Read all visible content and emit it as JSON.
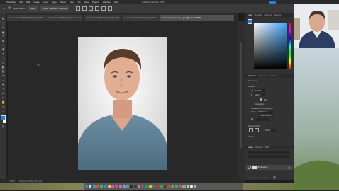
{
  "app": {
    "menus": [
      "Photoshop",
      "File",
      "Edit",
      "Image",
      "Layer",
      "Type",
      "Select",
      "Filter",
      "3D",
      "View",
      "Plugins",
      "Window",
      "Help"
    ],
    "window_title": "Adobe Photoshop 2024"
  },
  "options_bar": {
    "auto_select": "Auto-Select:",
    "layer_dropdown": "Layer",
    "show_transform": "Show Transform Controls"
  },
  "tabs": [
    {
      "label": "Adobe Stock 457698523.jpeg @ 16.7%"
    },
    {
      "label": "Adobe Stock 148765432.jpeg @ 16.7%"
    },
    {
      "label": "Adobe Stock 587542156.jpeg @ 16.7%"
    },
    {
      "label": "Adobe Stock 162458791.jpeg @ 16.7%"
    },
    {
      "label": "balloon_engagement_1.jpeg @ 17% (RGB/8)",
      "active": true
    }
  ],
  "status": {
    "zoom": "17.07%",
    "doc_info": "2700 px × 4048 px (300 ppi)"
  },
  "panels": {
    "top_tabs": [
      "Color",
      "Swatches",
      "Gradients",
      "Patterns"
    ],
    "mid_tabs": [
      "Properties",
      "Adjustments",
      "Libraries"
    ],
    "doc_label": "Document",
    "canvas_section": "Canvas",
    "width_label": "W",
    "width_value": "22.86 in",
    "height_label": "H",
    "height_value": "34.27 in",
    "orientation": "Orientation",
    "resolution_label": "Resolution:",
    "resolution_value": "300 Pixels/Inch",
    "mode_label": "Mode",
    "mode_value": "RGB Color",
    "bits_value": "8 Bits/Channel",
    "fill_label": "Fill",
    "rulers_section": "Rulers & Grids",
    "ruler_unit": "Inches",
    "guides_section": "Guides",
    "layers_tabs": [
      "Layers",
      "Channels",
      "Paths"
    ],
    "layer_name": "Background"
  },
  "colors": {
    "accent": "#2d7de0",
    "canvas_bg": "#282828",
    "panel_bg": "#323232"
  }
}
